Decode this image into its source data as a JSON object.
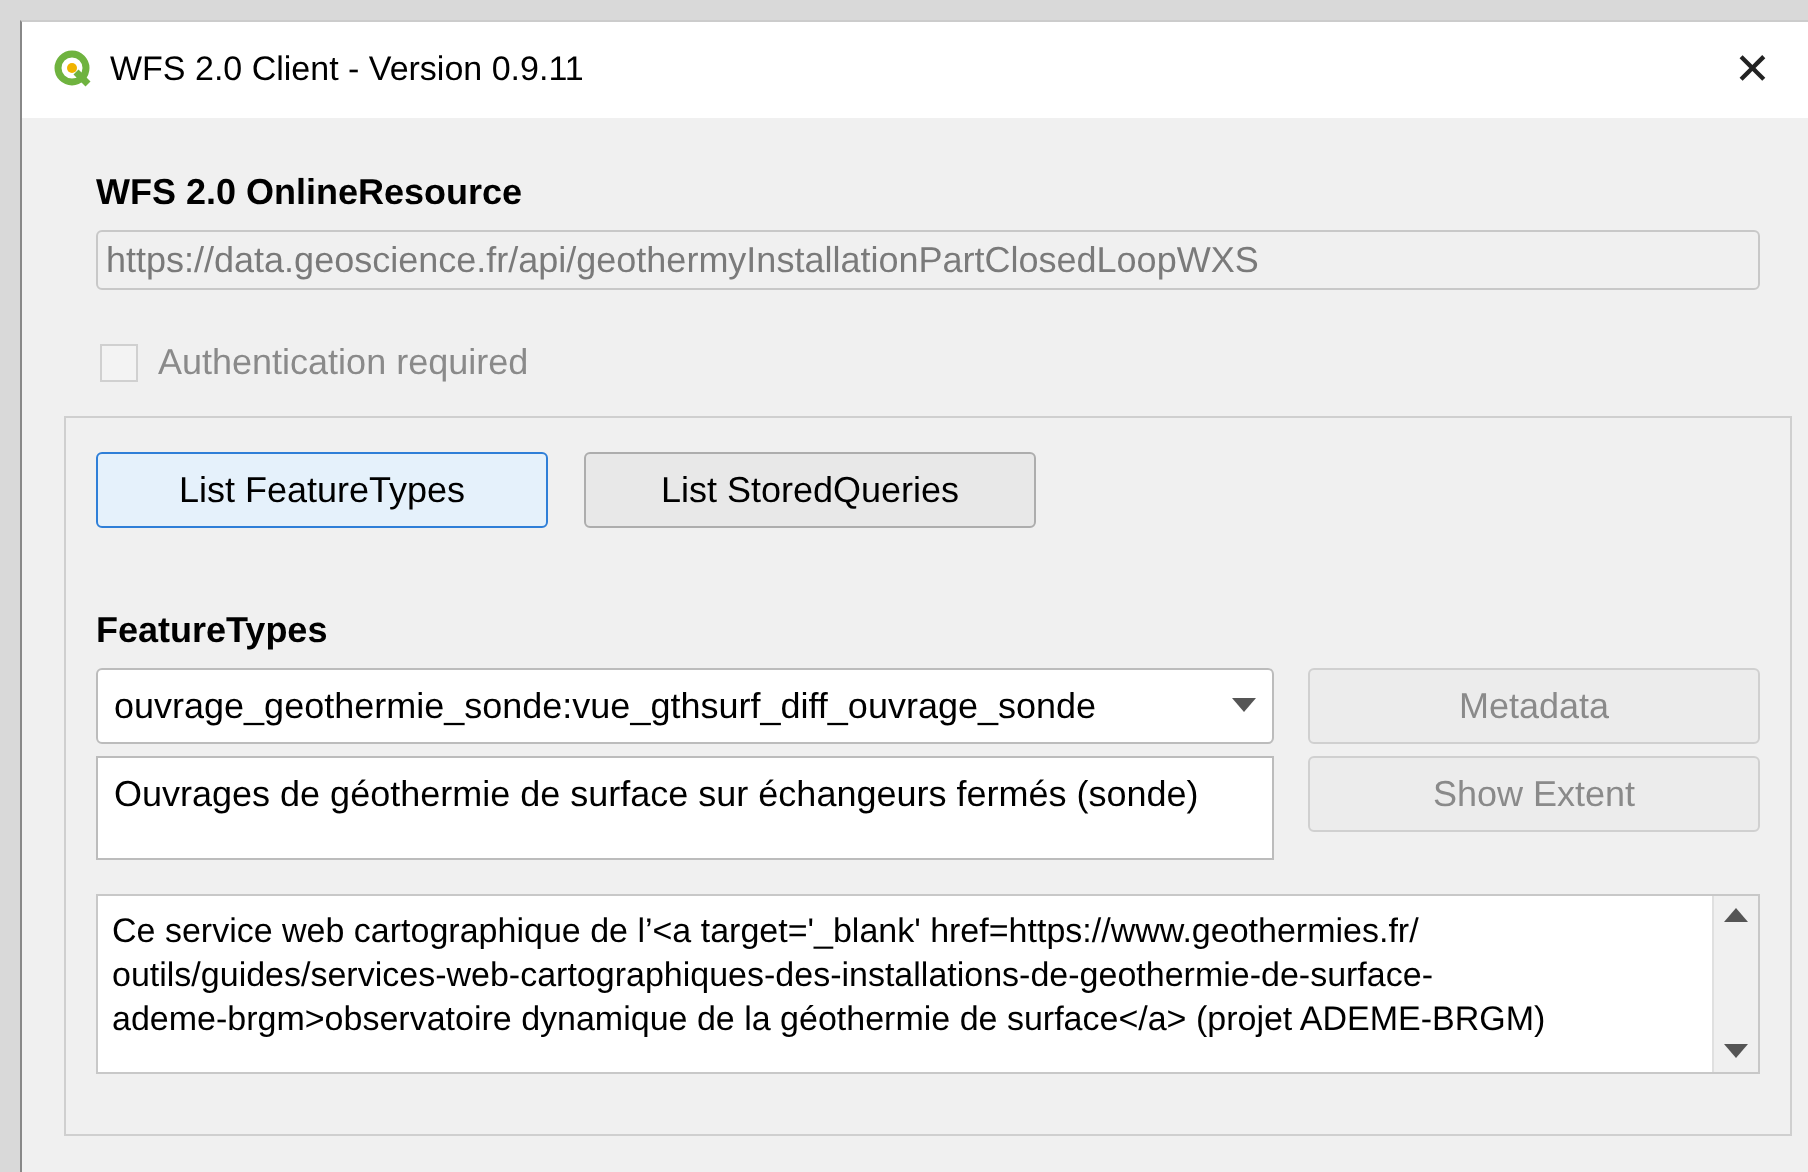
{
  "window": {
    "title": "WFS 2.0 Client - Version 0.9.11",
    "close": "✕"
  },
  "online_resource": {
    "label": "WFS 2.0 OnlineResource",
    "value": "https://data.geoscience.fr/api/geothermyInstallationPartClosedLoopWXS",
    "disabled": true
  },
  "authentication": {
    "label": "Authentication required",
    "checked": false,
    "disabled": true
  },
  "list_buttons": [
    {
      "label": "List FeatureTypes",
      "focused": true
    },
    {
      "label": "List StoredQueries",
      "focused": false
    }
  ],
  "feature_types": {
    "label": "FeatureTypes",
    "selected_value": "ouvrage_geothermie_sonde:vue_gthsurf_diff_ouvrage_sonde",
    "title": "Ouvrages de géothermie de surface sur échangeurs fermés (sonde)"
  },
  "side_buttons": [
    {
      "label": "Metadata",
      "disabled": true
    },
    {
      "label": "Show Extent",
      "disabled": true
    }
  ],
  "abstract": {
    "lines": [
      "Ce service web cartographique de l’<a target='_blank' href=https://www.geothermies.fr/",
      "outils/guides/services-web-cartographiques-des-installations-de-geothermie-de-surface-",
      "ademe-brgm>observatoire dynamique de la géothermie de surface</a> (projet ADEME-BRGM)"
    ]
  }
}
